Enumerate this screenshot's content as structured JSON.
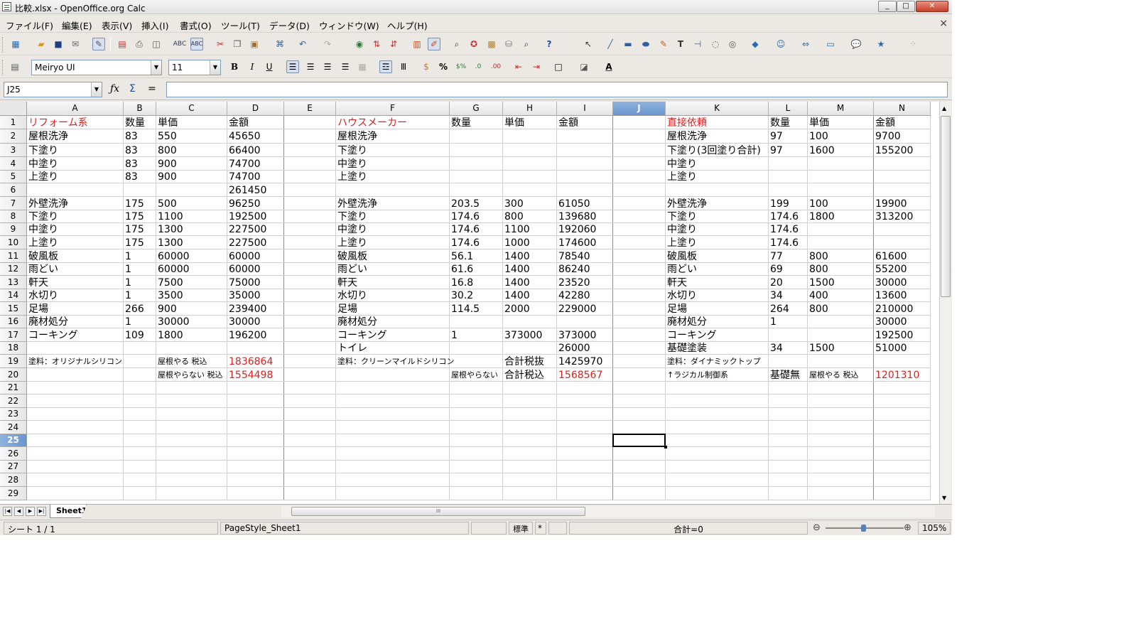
{
  "window": {
    "title": "比較.xlsx - OpenOffice.org Calc",
    "buttons": [
      "_",
      "□",
      "✕"
    ]
  },
  "menu": [
    "ファイル(F)",
    "編集(E)",
    "表示(V)",
    "挿入(I)",
    "書式(O)",
    "ツール(T)",
    "データ(D)",
    "ウィンドウ(W)",
    "ヘルプ(H)"
  ],
  "menu_close": "×",
  "toolbar1": [
    "new-icon",
    "open-icon",
    "save-icon",
    "email-icon",
    "edit-file-icon",
    "pdf-icon",
    "print-icon",
    "page-preview-icon",
    "spellcheck-icon",
    "autospell-icon",
    "cut-icon",
    "copy-icon",
    "paste-icon",
    "format-paintbrush-icon",
    "undo-icon",
    "redo-icon",
    "hyperlink-icon",
    "sort-ascending-icon",
    "sort-descending-icon",
    "chart-icon",
    "show-draw-icon",
    "find-replace-icon",
    "navigator-icon",
    "gallery-icon",
    "datasources-icon",
    "zoom-icon",
    "help-icon",
    "select-icon",
    "line-icon",
    "rectangle-icon",
    "ellipse-icon",
    "freeform-icon",
    "text-icon",
    "connector-icon",
    "callout-icon",
    "gluepoint-icon",
    "basic-shapes-icon",
    "symbol-shapes-icon",
    "block-arrows-icon",
    "flowchart-icon",
    "callouts-icon",
    "stars-icon",
    "points-icon"
  ],
  "toolbar2": {
    "font_name": "Meiryo UI",
    "font_size": "11",
    "formatting": [
      "bold-icon",
      "italic-icon",
      "underline-icon",
      "align-left-icon",
      "align-center-icon",
      "align-right-icon",
      "justify-icon",
      "merge-cells-icon",
      "wrap-text-icon",
      "vertical-text-icon",
      "currency-icon",
      "percent-icon",
      "number-format-icon",
      "add-decimal-icon",
      "delete-decimal-icon",
      "decrease-indent-icon",
      "increase-indent-icon",
      "borders-icon",
      "background-color-icon",
      "font-color-icon"
    ],
    "labels": {
      "bold": "B",
      "italic": "I",
      "underline": "U",
      "percent": "%",
      "font_color": "A"
    }
  },
  "formula": {
    "cell_ref": "J25",
    "fx": "ƒx",
    "sum": "Σ",
    "equals": "=",
    "content": ""
  },
  "columns": [
    "A",
    "B",
    "C",
    "D",
    "E",
    "F",
    "G",
    "H",
    "I",
    "J",
    "K",
    "L",
    "M",
    "N"
  ],
  "selected_column": "J",
  "rows": [
    "1",
    "2",
    "3",
    "4",
    "5",
    "6",
    "7",
    "8",
    "9",
    "10",
    "11",
    "12",
    "13",
    "14",
    "15",
    "16",
    "17",
    "18",
    "19",
    "20",
    "21",
    "22",
    "23",
    "24",
    "25",
    "26",
    "27",
    "28",
    "29"
  ],
  "selected_row": "25",
  "cells": [
    {
      "ref": "A1",
      "v": "リフォーム系",
      "red": true
    },
    {
      "ref": "B1",
      "v": "数量"
    },
    {
      "ref": "C1",
      "v": "単価"
    },
    {
      "ref": "D1",
      "v": "金額"
    },
    {
      "ref": "F1",
      "v": "ハウスメーカー",
      "red": true
    },
    {
      "ref": "G1",
      "v": "数量"
    },
    {
      "ref": "H1",
      "v": "単価"
    },
    {
      "ref": "I1",
      "v": "金額"
    },
    {
      "ref": "K1",
      "v": "直接依頼",
      "red": true
    },
    {
      "ref": "L1",
      "v": "数量"
    },
    {
      "ref": "M1",
      "v": "単価"
    },
    {
      "ref": "N1",
      "v": "金額"
    },
    {
      "ref": "A2",
      "v": "屋根洗浄"
    },
    {
      "ref": "B2",
      "v": "83"
    },
    {
      "ref": "C2",
      "v": "550"
    },
    {
      "ref": "D2",
      "v": "45650"
    },
    {
      "ref": "F2",
      "v": "屋根洗浄"
    },
    {
      "ref": "K2",
      "v": "屋根洗浄"
    },
    {
      "ref": "L2",
      "v": "97"
    },
    {
      "ref": "M2",
      "v": "100"
    },
    {
      "ref": "N2",
      "v": "9700"
    },
    {
      "ref": "A3",
      "v": "下塗り"
    },
    {
      "ref": "B3",
      "v": "83"
    },
    {
      "ref": "C3",
      "v": "800"
    },
    {
      "ref": "D3",
      "v": "66400"
    },
    {
      "ref": "F3",
      "v": "下塗り"
    },
    {
      "ref": "K3",
      "v": "下塗り(3回塗り合計)"
    },
    {
      "ref": "L3",
      "v": "97"
    },
    {
      "ref": "M3",
      "v": "1600"
    },
    {
      "ref": "N3",
      "v": "155200"
    },
    {
      "ref": "A4",
      "v": "中塗り"
    },
    {
      "ref": "B4",
      "v": "83"
    },
    {
      "ref": "C4",
      "v": "900"
    },
    {
      "ref": "D4",
      "v": "74700"
    },
    {
      "ref": "F4",
      "v": "中塗り"
    },
    {
      "ref": "K4",
      "v": "中塗り"
    },
    {
      "ref": "A5",
      "v": "上塗り"
    },
    {
      "ref": "B5",
      "v": "83"
    },
    {
      "ref": "C5",
      "v": "900"
    },
    {
      "ref": "D5",
      "v": "74700"
    },
    {
      "ref": "F5",
      "v": "上塗り"
    },
    {
      "ref": "K5",
      "v": "上塗り"
    },
    {
      "ref": "D6",
      "v": "261450"
    },
    {
      "ref": "A7",
      "v": "外壁洗浄"
    },
    {
      "ref": "B7",
      "v": "175"
    },
    {
      "ref": "C7",
      "v": "500"
    },
    {
      "ref": "D7",
      "v": "96250"
    },
    {
      "ref": "F7",
      "v": "外壁洗浄"
    },
    {
      "ref": "G7",
      "v": "203.5"
    },
    {
      "ref": "H7",
      "v": "300"
    },
    {
      "ref": "I7",
      "v": "61050"
    },
    {
      "ref": "K7",
      "v": "外壁洗浄"
    },
    {
      "ref": "L7",
      "v": "199"
    },
    {
      "ref": "M7",
      "v": "100"
    },
    {
      "ref": "N7",
      "v": "19900"
    },
    {
      "ref": "A8",
      "v": "下塗り"
    },
    {
      "ref": "B8",
      "v": "175"
    },
    {
      "ref": "C8",
      "v": "1100"
    },
    {
      "ref": "D8",
      "v": "192500"
    },
    {
      "ref": "F8",
      "v": "下塗り"
    },
    {
      "ref": "G8",
      "v": "174.6"
    },
    {
      "ref": "H8",
      "v": "800"
    },
    {
      "ref": "I8",
      "v": "139680"
    },
    {
      "ref": "K8",
      "v": "下塗り"
    },
    {
      "ref": "L8",
      "v": "174.6"
    },
    {
      "ref": "M8",
      "v": "1800"
    },
    {
      "ref": "N8",
      "v": "313200"
    },
    {
      "ref": "A9",
      "v": "中塗り"
    },
    {
      "ref": "B9",
      "v": "175"
    },
    {
      "ref": "C9",
      "v": "1300"
    },
    {
      "ref": "D9",
      "v": "227500"
    },
    {
      "ref": "F9",
      "v": "中塗り"
    },
    {
      "ref": "G9",
      "v": "174.6"
    },
    {
      "ref": "H9",
      "v": "1100"
    },
    {
      "ref": "I9",
      "v": "192060"
    },
    {
      "ref": "K9",
      "v": "中塗り"
    },
    {
      "ref": "L9",
      "v": "174.6"
    },
    {
      "ref": "A10",
      "v": "上塗り"
    },
    {
      "ref": "B10",
      "v": "175"
    },
    {
      "ref": "C10",
      "v": "1300"
    },
    {
      "ref": "D10",
      "v": "227500"
    },
    {
      "ref": "F10",
      "v": "上塗り"
    },
    {
      "ref": "G10",
      "v": "174.6"
    },
    {
      "ref": "H10",
      "v": "1000"
    },
    {
      "ref": "I10",
      "v": "174600"
    },
    {
      "ref": "K10",
      "v": "上塗り"
    },
    {
      "ref": "L10",
      "v": "174.6"
    },
    {
      "ref": "A11",
      "v": "破風板"
    },
    {
      "ref": "B11",
      "v": "1"
    },
    {
      "ref": "C11",
      "v": "60000"
    },
    {
      "ref": "D11",
      "v": "60000"
    },
    {
      "ref": "F11",
      "v": "破風板"
    },
    {
      "ref": "G11",
      "v": "56.1"
    },
    {
      "ref": "H11",
      "v": "1400"
    },
    {
      "ref": "I11",
      "v": "78540"
    },
    {
      "ref": "K11",
      "v": "破風板"
    },
    {
      "ref": "L11",
      "v": "77"
    },
    {
      "ref": "M11",
      "v": "800"
    },
    {
      "ref": "N11",
      "v": "61600"
    },
    {
      "ref": "A12",
      "v": "雨どい"
    },
    {
      "ref": "B12",
      "v": "1"
    },
    {
      "ref": "C12",
      "v": "60000"
    },
    {
      "ref": "D12",
      "v": "60000"
    },
    {
      "ref": "F12",
      "v": "雨どい"
    },
    {
      "ref": "G12",
      "v": "61.6"
    },
    {
      "ref": "H12",
      "v": "1400"
    },
    {
      "ref": "I12",
      "v": "86240"
    },
    {
      "ref": "K12",
      "v": "雨どい"
    },
    {
      "ref": "L12",
      "v": "69"
    },
    {
      "ref": "M12",
      "v": "800"
    },
    {
      "ref": "N12",
      "v": "55200"
    },
    {
      "ref": "A13",
      "v": "軒天"
    },
    {
      "ref": "B13",
      "v": "1"
    },
    {
      "ref": "C13",
      "v": "7500"
    },
    {
      "ref": "D13",
      "v": "75000"
    },
    {
      "ref": "F13",
      "v": "軒天"
    },
    {
      "ref": "G13",
      "v": "16.8"
    },
    {
      "ref": "H13",
      "v": "1400"
    },
    {
      "ref": "I13",
      "v": "23520"
    },
    {
      "ref": "K13",
      "v": "軒天"
    },
    {
      "ref": "L13",
      "v": "20"
    },
    {
      "ref": "M13",
      "v": "1500"
    },
    {
      "ref": "N13",
      "v": "30000"
    },
    {
      "ref": "A14",
      "v": "水切り"
    },
    {
      "ref": "B14",
      "v": "1"
    },
    {
      "ref": "C14",
      "v": "3500"
    },
    {
      "ref": "D14",
      "v": "35000"
    },
    {
      "ref": "F14",
      "v": "水切り"
    },
    {
      "ref": "G14",
      "v": "30.2"
    },
    {
      "ref": "H14",
      "v": "1400"
    },
    {
      "ref": "I14",
      "v": "42280"
    },
    {
      "ref": "K14",
      "v": "水切り"
    },
    {
      "ref": "L14",
      "v": "34"
    },
    {
      "ref": "M14",
      "v": "400"
    },
    {
      "ref": "N14",
      "v": "13600"
    },
    {
      "ref": "A15",
      "v": "足場"
    },
    {
      "ref": "B15",
      "v": "266"
    },
    {
      "ref": "C15",
      "v": "900"
    },
    {
      "ref": "D15",
      "v": "239400"
    },
    {
      "ref": "F15",
      "v": "足場"
    },
    {
      "ref": "G15",
      "v": "114.5"
    },
    {
      "ref": "H15",
      "v": "2000"
    },
    {
      "ref": "I15",
      "v": "229000"
    },
    {
      "ref": "K15",
      "v": "足場"
    },
    {
      "ref": "L15",
      "v": "264"
    },
    {
      "ref": "M15",
      "v": "800"
    },
    {
      "ref": "N15",
      "v": "210000"
    },
    {
      "ref": "A16",
      "v": "廃材処分"
    },
    {
      "ref": "B16",
      "v": "1"
    },
    {
      "ref": "C16",
      "v": "30000"
    },
    {
      "ref": "D16",
      "v": "30000"
    },
    {
      "ref": "F16",
      "v": "廃材処分"
    },
    {
      "ref": "K16",
      "v": "廃材処分"
    },
    {
      "ref": "L16",
      "v": "1"
    },
    {
      "ref": "N16",
      "v": "30000"
    },
    {
      "ref": "A17",
      "v": "コーキング"
    },
    {
      "ref": "B17",
      "v": "109"
    },
    {
      "ref": "C17",
      "v": "1800"
    },
    {
      "ref": "D17",
      "v": "196200"
    },
    {
      "ref": "F17",
      "v": "コーキング"
    },
    {
      "ref": "G17",
      "v": "1"
    },
    {
      "ref": "H17",
      "v": "373000"
    },
    {
      "ref": "I17",
      "v": "373000"
    },
    {
      "ref": "K17",
      "v": "コーキング"
    },
    {
      "ref": "N17",
      "v": "192500"
    },
    {
      "ref": "F18",
      "v": "トイレ"
    },
    {
      "ref": "I18",
      "v": "26000"
    },
    {
      "ref": "K18",
      "v": "基礎塗装"
    },
    {
      "ref": "L18",
      "v": "34"
    },
    {
      "ref": "M18",
      "v": "1500"
    },
    {
      "ref": "N18",
      "v": "51000"
    },
    {
      "ref": "A19",
      "v": "塗料：オリジナルシリコン",
      "small": true
    },
    {
      "ref": "C19",
      "v": "屋根やる  税込",
      "small": true
    },
    {
      "ref": "D19",
      "v": "1836864",
      "red": true
    },
    {
      "ref": "F19",
      "v": "塗料：クリーンマイルドシリコン",
      "small": true
    },
    {
      "ref": "H19",
      "v": "合計税抜"
    },
    {
      "ref": "I19",
      "v": "1425970"
    },
    {
      "ref": "K19",
      "v": "塗料：ダイナミックトップ",
      "small": true
    },
    {
      "ref": "C20",
      "v": "屋根やらない  税込",
      "small": true
    },
    {
      "ref": "D20",
      "v": "1554498",
      "red": true
    },
    {
      "ref": "G20",
      "v": "屋根やらない",
      "small": true
    },
    {
      "ref": "H20",
      "v": "合計税込"
    },
    {
      "ref": "I20",
      "v": "1568567",
      "red": true
    },
    {
      "ref": "K20",
      "v": "↑ラジカル制御系",
      "small": true
    },
    {
      "ref": "L20",
      "v": "基礎無"
    },
    {
      "ref": "M20",
      "v": "屋根やる  税込",
      "small": true
    },
    {
      "ref": "N20",
      "v": "1201310",
      "red": true
    }
  ],
  "sheet_tab": "Sheet1",
  "status": {
    "sheet": "シート 1 / 1",
    "page_style": "PageStyle_Sheet1",
    "mode": "標準",
    "modified": "*",
    "sum": "合計=0",
    "zoom": "105%",
    "zoom_minus": "⊖",
    "zoom_plus": "⊕"
  },
  "colors": {
    "red": "#e02020",
    "selection": "#6a95cc"
  }
}
